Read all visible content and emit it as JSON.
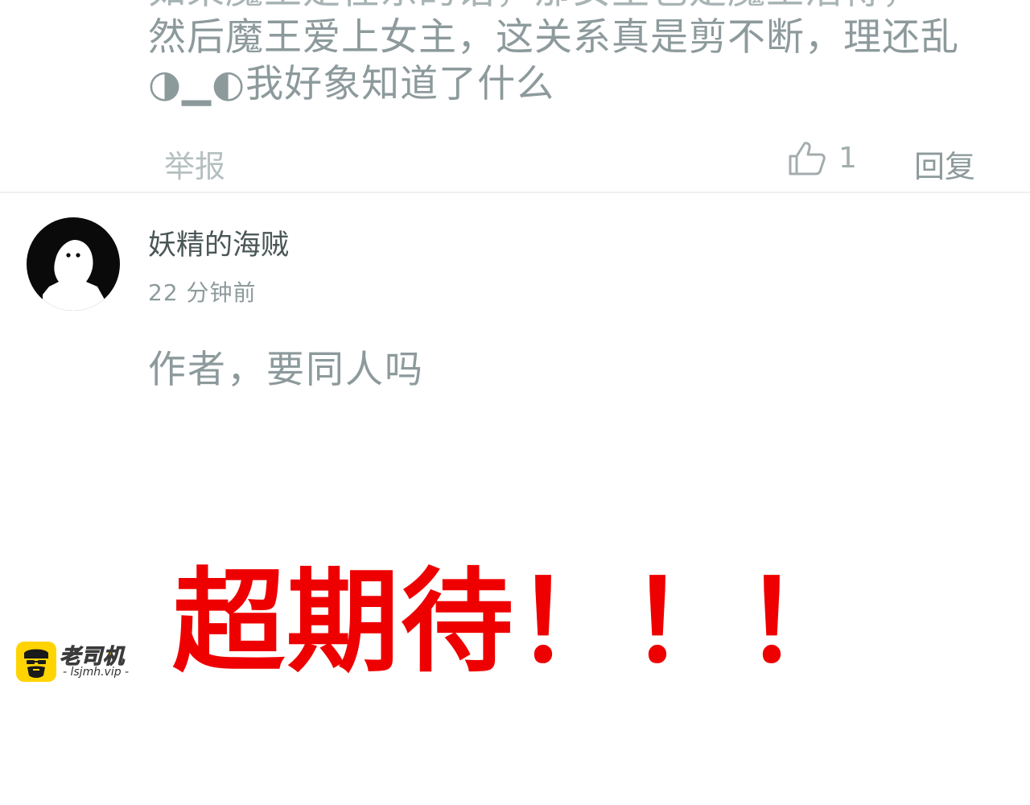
{
  "previous_comment": {
    "lines": [
      "如果魔王是往东的话，那女主也是魔王活得，",
      "然后魔王爱上女主，这关系真是剪不断，理还乱",
      "◑▁◐我好象知道了什么"
    ],
    "actions": {
      "report_label": "举报",
      "like_count": "1",
      "reply_label": "回复"
    }
  },
  "comment": {
    "username": "妖精的海贼",
    "timestamp": "22 分钟前",
    "body": "作者，要同人吗"
  },
  "banner": {
    "text": "超期待！！！"
  },
  "watermark": {
    "brand": "老司机",
    "url": "- lsjmh.vip -"
  },
  "colors": {
    "text_muted": "#8d9a9c",
    "username": "#4a5657",
    "banner_red": "#ee0000",
    "logo_yellow": "#ffd400"
  },
  "icons": {
    "like": "thumbs-up-icon",
    "avatar": "ghost-avatar-icon"
  }
}
